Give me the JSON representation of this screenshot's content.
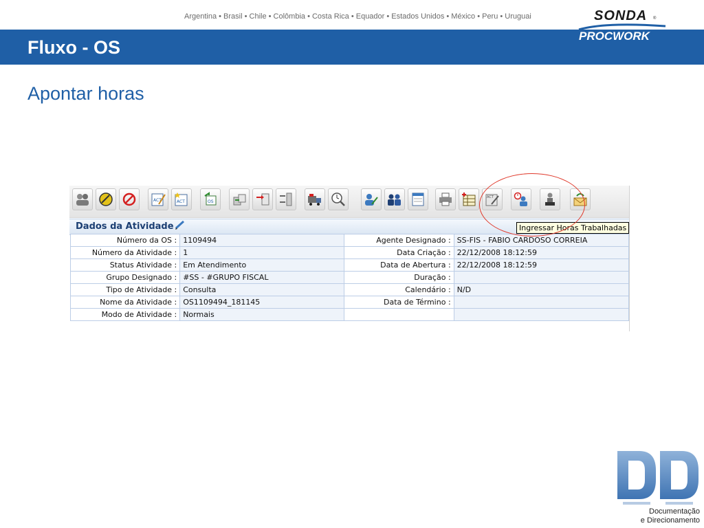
{
  "header": {
    "countries": "Argentina • Brasil • Chile • Colômbia • Costa Rica • Equador • Estados Unidos • México • Peru • Uruguai",
    "logo_top": "SONDA",
    "logo_bottom": "PROCWORK",
    "title": "Fluxo - OS"
  },
  "subtitle": "Apontar horas",
  "app": {
    "toolbar": {
      "buttons": [
        {
          "icon": "group-users-icon"
        },
        {
          "icon": "yellow-stop-icon"
        },
        {
          "icon": "cancel-icon"
        },
        {
          "icon": "act-edit-icon"
        },
        {
          "icon": "act-new-icon"
        },
        {
          "icon": "os-return-icon"
        },
        {
          "icon": "transfer-icon"
        },
        {
          "icon": "forward-icon"
        },
        {
          "icon": "swap-icon"
        },
        {
          "icon": "truck-icon"
        },
        {
          "icon": "clock-search-icon"
        },
        {
          "icon": "user-edit-icon"
        },
        {
          "icon": "group-icon"
        },
        {
          "icon": "calendar-icon"
        },
        {
          "icon": "printer-icon"
        },
        {
          "icon": "spreadsheet-add-icon"
        },
        {
          "icon": "act-report-icon"
        },
        {
          "icon": "user-clock-icon"
        },
        {
          "icon": "user-stamp-icon"
        },
        {
          "icon": "mail-refresh-icon"
        }
      ]
    },
    "section_title": "Dados da Atividade",
    "tooltip": "Ingressar Horas Trabalhadas",
    "rows": [
      {
        "l1": "Número da OS :",
        "v1": "1109494",
        "l2": "Agente Designado :",
        "v2": "SS-FIS - FABIO CARDOSO CORREIA"
      },
      {
        "l1": "Número da Atividade :",
        "v1": "1",
        "l2": "Data Criação :",
        "v2": "22/12/2008 18:12:59"
      },
      {
        "l1": "Status Atividade :",
        "v1": "Em Atendimento",
        "l2": "Data de Abertura :",
        "v2": "22/12/2008 18:12:59"
      },
      {
        "l1": "Grupo Designado :",
        "v1": "#SS - #GRUPO FISCAL",
        "l2": "Duração :",
        "v2": ""
      },
      {
        "l1": "Tipo de Atividade :",
        "v1": "Consulta",
        "l2": "Calendário :",
        "v2": "N/D"
      },
      {
        "l1": "Nome da Atividade :",
        "v1": "OS1109494_181145",
        "l2": "Data de Término :",
        "v2": ""
      },
      {
        "l1": "Modo de Atividade :",
        "v1": "Normais",
        "l2": "",
        "v2": ""
      }
    ]
  },
  "footer": {
    "logo_letters": "DD",
    "caption_line1": "Documentação",
    "caption_line2": "e Direcionamento"
  },
  "colors": {
    "brand_blue": "#1f5fa6",
    "annotation_red": "#e0392b"
  }
}
